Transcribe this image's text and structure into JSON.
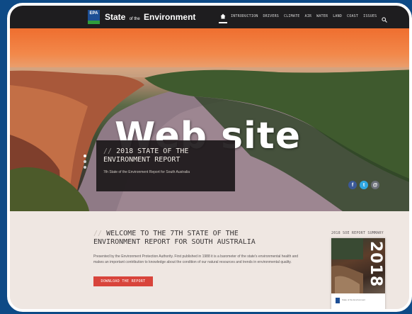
{
  "header": {
    "logo_text": "EPA",
    "title_main": "State",
    "title_small": "of the",
    "title_end": "Environment",
    "nav": [
      "INTRODUCTION",
      "DRIVERS",
      "CLIMATE",
      "AIR",
      "WATER",
      "LAND",
      "COAST",
      "ISSUES"
    ]
  },
  "overlay": {
    "text": "Web site"
  },
  "hero": {
    "box_slash": "//",
    "box_title_line1": "2018 STATE OF THE",
    "box_title_line2": "ENVIRONMENT REPORT",
    "box_subtitle": "7th State of the Environment Report for South Australia"
  },
  "main": {
    "slash": "//",
    "welcome_line1": "WELCOME TO THE 7TH STATE OF THE",
    "welcome_line2": "ENVIRONMENT REPORT FOR SOUTH AUSTRALIA",
    "body": "Presented by the Environment Protection Authority. First published in 1988 it is a barometer of the state's environmental health and makes an important contribution to knowledge about the condition of our natural resources and trends in environmental quality.",
    "download_label": "DOWNLOAD THE REPORT"
  },
  "sidebar": {
    "summary_label": "2018 SOE REPORT SUMMARY",
    "cover_year": "2018",
    "cover_footer": "State of the Environment"
  },
  "social": {
    "facebook": "f",
    "twitter": "t",
    "email": "@"
  },
  "colors": {
    "accent": "#d8443b",
    "topbar": "#1e1d1f",
    "frame": "#ffffff",
    "background": "#0e4a86"
  }
}
